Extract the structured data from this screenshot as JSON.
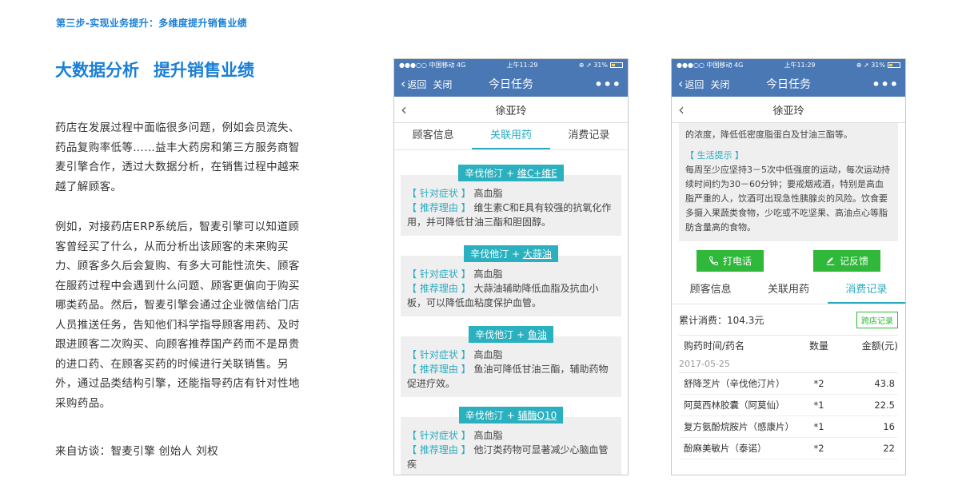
{
  "step_title": "第三步-实现业务提升：多维度提升销售业绩",
  "main_title": {
    "part1": "大数据分析",
    "part2": "提升销售业绩"
  },
  "paragraph1": "药店在发展过程中面临很多问题，例如会员流失、药品复购率低等……益丰大药房和第三方服务商智麦引擎合作，透过大数据分析，在销售过程中越来越了解顾客。",
  "paragraph2": "例如，对接药店ERP系统后，智麦引擎可以知道顾客曾经买了什么，从而分析出该顾客的未来购买力、顾客多久后会复购、有多大可能性流失、顾客在服药过程中会遇到什么问题、顾客更偏向于购买哪类药品。然后，智麦引擎会通过企业微信给门店人员推送任务，告知他们科学指导顾客用药、及时跟进顾客二次购买、向顾客推荐国产药而不是昂贵的进口药、在顾客买药的时候进行关联销售。另外，通过品类结构引擎，还能指导药店有针对性地采购药品。",
  "source": "来自访谈：智麦引擎 创始人 刘权",
  "phone_common": {
    "carrier": "●●●○○ 中国移动  4G",
    "time": "上午11:29",
    "battery": "31%",
    "nav_back": "返回",
    "nav_close": "关闭",
    "nav_title": "今日任务",
    "nav_more": "•••",
    "customer_name": "徐亚玲",
    "tabs": [
      "顾客信息",
      "关联用药",
      "消费记录"
    ]
  },
  "phone1": {
    "drugs": [
      {
        "base": "辛伐他汀 + ",
        "linked": "维C+维E",
        "symptom_label": "【 针对症状 】",
        "symptom": "高血脂",
        "reason_label": "【 推荐理由 】",
        "reason": "维生素C和E具有较强的抗氧化作用，并可降低甘油三酯和胆固醇。"
      },
      {
        "base": "辛伐他汀 + ",
        "linked": "大蒜油",
        "symptom_label": "【 针对症状 】",
        "symptom": "高血脂",
        "reason_label": "【 推荐理由 】",
        "reason": "大蒜油辅助降低血脂及抗血小板，可以降低血粘度保护血管。"
      },
      {
        "base": "辛伐他汀 + ",
        "linked": "鱼油",
        "symptom_label": "【 针对症状 】",
        "symptom": "高血脂",
        "reason_label": "【 推荐理由 】",
        "reason": "鱼油可降低甘油三酯，辅助药物促进疗效。"
      },
      {
        "base": "辛伐他汀 + ",
        "linked": "辅酶Q10",
        "symptom_label": "【 针对症状 】",
        "symptom": "高血脂",
        "reason_label": "【 推荐理由 】",
        "reason": "他汀类药物可显著减少心脑血管疾"
      }
    ]
  },
  "phone2": {
    "advice_top": "的浓度，降低低密度脂蛋白及甘油三酯等。",
    "life_tip_label": "【 生活提示 】",
    "life_tip": "每周至少应坚持3－5次中低强度的运动，每次运动持续时间约为30－60分钟；要戒烟戒酒，特别是高血脂严重的人，饮酒可出现急性胰腺炎的风险。饮食要多摄入果蔬类食物，少吃或不吃坚果、高油点心等脂肪含量高的食物。",
    "call_button": "打电话",
    "feedback_button": "记反馈",
    "total_label": "累计消费：104.3元",
    "store_record_button": "跨店记录",
    "table_headers": [
      "购药时间/药名",
      "数量",
      "金额(元)"
    ],
    "date": "2017-05-25",
    "rows": [
      {
        "name": "舒降芝片（辛伐他汀片）",
        "qty": "*2",
        "amount": "43.8"
      },
      {
        "name": "阿莫西林胶囊（阿莫仙）",
        "qty": "*1",
        "amount": "22.5"
      },
      {
        "name": "复方氨酚烷胺片（感康片）",
        "qty": "*1",
        "amount": "16"
      },
      {
        "name": "酚麻美敏片（泰诺）",
        "qty": "*2",
        "amount": "22"
      }
    ]
  }
}
